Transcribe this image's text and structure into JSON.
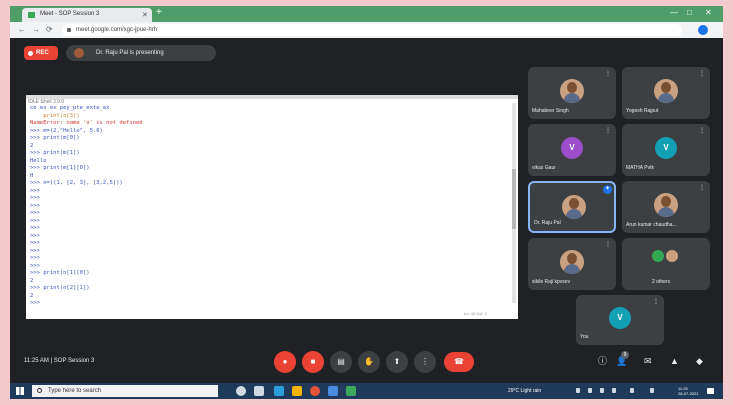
{
  "browser": {
    "tab_title": "Meet - SOP Session 3",
    "tab_close": "✕",
    "new_tab": "+",
    "url": "meet.google.com/xgc-jpue-hrh",
    "window_controls": [
      "—",
      "□",
      "✕"
    ],
    "nav": [
      "←",
      "→",
      "⟳"
    ]
  },
  "meet": {
    "rec_label": "REC",
    "presenting_text": "Dr. Raju Pal is presenting",
    "shared_screen": {
      "title": "IDLE Shell 3.9.0",
      "code_lines": [
        {
          "text": "ce ex ex pey_pte_exte_ex",
          "cls": "c-blue"
        },
        {
          "text": "    print(o[3])",
          "cls": "c-orange"
        },
        {
          "text": "NameError: name 'o' is not defined",
          "cls": "c-red"
        },
        {
          "text": ">>> m=(2,\"Hello\", 5.6)",
          "cls": "c-blue"
        },
        {
          "text": ">>> print(m[0])",
          "cls": "c-blue"
        },
        {
          "text": "2",
          "cls": "c-blue"
        },
        {
          "text": ">>> print(m[1])",
          "cls": "c-blue"
        },
        {
          "text": "Hello",
          "cls": "c-blue"
        },
        {
          "text": ">>> print(m[1][0])",
          "cls": "c-blue"
        },
        {
          "text": "H",
          "cls": "c-blue"
        },
        {
          "text": ">>> n=((1, [2, 3], [3,2,5]))",
          "cls": "c-blue"
        },
        {
          "text": ">>>",
          "cls": "c-blue"
        },
        {
          "text": ">>>",
          "cls": "c-blue"
        },
        {
          "text": ">>>",
          "cls": "c-blue"
        },
        {
          "text": ">>>",
          "cls": "c-blue"
        },
        {
          "text": ">>>",
          "cls": "c-blue"
        },
        {
          "text": ">>>",
          "cls": "c-blue"
        },
        {
          "text": ">>>",
          "cls": "c-blue"
        },
        {
          "text": ">>>",
          "cls": "c-blue"
        },
        {
          "text": ">>>",
          "cls": "c-blue"
        },
        {
          "text": ">>>",
          "cls": "c-blue"
        },
        {
          "text": ">>>",
          "cls": "c-blue"
        },
        {
          "text": ">>> print(n[1][0])",
          "cls": "c-blue"
        },
        {
          "text": "2",
          "cls": "c-blue"
        },
        {
          "text": ">>> print(n[2][1])",
          "cls": "c-blue"
        },
        {
          "text": "2",
          "cls": "c-blue"
        },
        {
          "text": ">>>",
          "cls": "c-blue"
        }
      ],
      "status": "Ln: 42 Col: 4"
    },
    "participants": [
      {
        "name": "Mahabeer Singh",
        "kind": "photo"
      },
      {
        "name": "Yogesh Rajput",
        "kind": "photo"
      },
      {
        "name": "vikas Gaur",
        "kind": "letter",
        "letter": "V",
        "color": "#9c4dcc"
      },
      {
        "name": "MATHA Pvtk",
        "kind": "letter",
        "letter": "V",
        "color": "#12a0b5"
      },
      {
        "name": "Dr. Raju Pal",
        "kind": "photo",
        "active": true
      },
      {
        "name": "Arun kumar chaudha...",
        "kind": "photo"
      },
      {
        "name": "sikile Raji kpvsev",
        "kind": "photo"
      },
      {
        "name": "2 others",
        "kind": "others"
      },
      {
        "name": "You",
        "kind": "letter",
        "letter": "V",
        "color": "#12a0b5"
      }
    ],
    "meeting_info": "11:25 AM  |  SOP Session 3",
    "controls": {
      "mic": "●",
      "cam": "■",
      "captions": "▤",
      "raise_hand": "✋",
      "present": "⬆",
      "more": "⋮",
      "end": "☎"
    },
    "side_controls": {
      "info": "ⓘ",
      "people": "👤",
      "people_count": "9",
      "chat": "✉",
      "activities": "▲",
      "security": "◆"
    }
  },
  "taskbar": {
    "search_placeholder": "Type here to search",
    "weather": "29°C  Light rain",
    "clock_time": "11:25",
    "clock_date": "28-07-2021"
  }
}
